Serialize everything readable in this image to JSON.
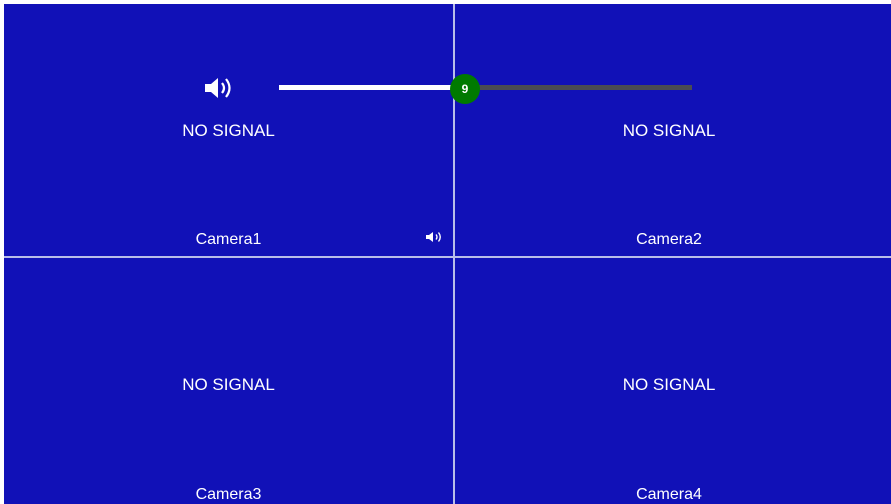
{
  "volume": {
    "icon": "speaker-icon",
    "value": 9,
    "max": 20,
    "fill_color": "#ffffff",
    "track_color": "#4a4c52",
    "thumb_color": "#007a00"
  },
  "colors": {
    "background": "#1111b7",
    "divider": "#b9bde9",
    "text": "#ffffff"
  },
  "cameras": [
    {
      "name": "Camera1",
      "status": "NO SIGNAL",
      "audio_icon": "speaker-icon"
    },
    {
      "name": "Camera2",
      "status": "NO SIGNAL"
    },
    {
      "name": "Camera3",
      "status": "NO SIGNAL"
    },
    {
      "name": "Camera4",
      "status": "NO SIGNAL"
    }
  ]
}
